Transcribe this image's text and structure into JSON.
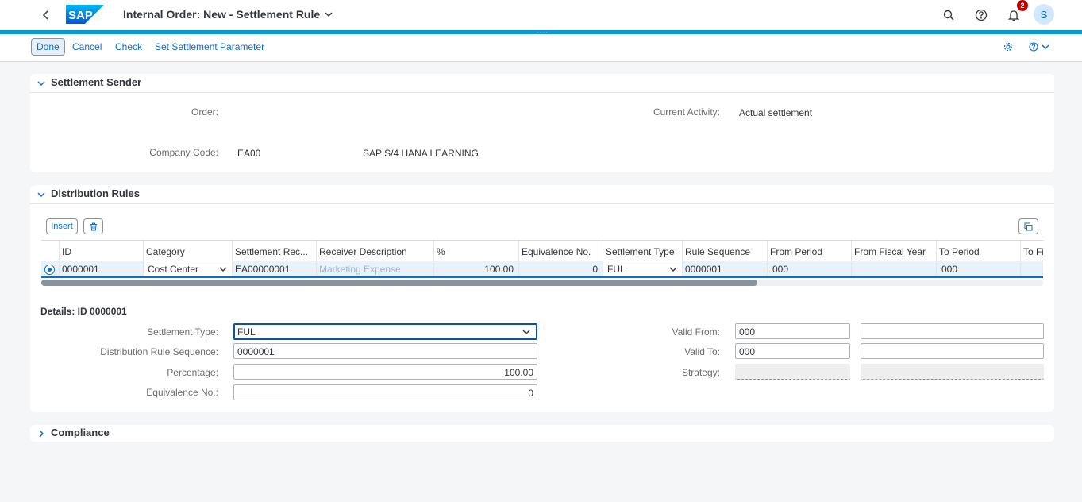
{
  "shell": {
    "title": "Internal Order: New - Settlement Rule",
    "notification_count": "2",
    "avatar_initial": "S",
    "logo_text": "SAP"
  },
  "toolbar": {
    "done": "Done",
    "cancel": "Cancel",
    "check": "Check",
    "set_param": "Set Settlement Parameter"
  },
  "sender": {
    "title": "Settlement Sender",
    "order_label": "Order:",
    "order_value": "",
    "activity_label": "Current Activity:",
    "activity_value": "Actual settlement",
    "company_label": "Company Code:",
    "company_code": "EA00",
    "company_name": "SAP S/4 HANA LEARNING"
  },
  "distribution": {
    "title": "Distribution Rules",
    "insert_label": "Insert",
    "columns": [
      "ID",
      "Category",
      "Settlement Rec...",
      "Receiver Description",
      "%",
      "Equivalence No.",
      "Settlement Type",
      "Rule Sequence",
      "From Period",
      "From Fiscal Year",
      "To Period",
      "To Fis"
    ],
    "row": {
      "id": "0000001",
      "category": "Cost Center",
      "receiver": "EA00000001",
      "description": "Marketing Expense",
      "percent": "100.00",
      "equivalence": "0",
      "settlement_type": "FUL",
      "rule_sequence": "0000001",
      "from_period": "000",
      "from_fiscal_year": "",
      "to_period": "000",
      "to_fiscal": ""
    }
  },
  "details": {
    "title": "Details: ID 0000001",
    "settlement_type_label": "Settlement Type:",
    "settlement_type_value": "FUL",
    "rule_sequence_label": "Distribution Rule Sequence:",
    "rule_sequence_value": "0000001",
    "percentage_label": "Percentage:",
    "percentage_value": "100.00",
    "equivalence_label": "Equivalence No.:",
    "equivalence_value": "0",
    "valid_from_label": "Valid From:",
    "valid_from_value": "000",
    "valid_from_year": "",
    "valid_to_label": "Valid To:",
    "valid_to_value": "000",
    "valid_to_year": "",
    "strategy_label": "Strategy:",
    "strategy_value": ""
  },
  "compliance": {
    "title": "Compliance"
  },
  "colors": {
    "accent": "#0a6ed1",
    "shell_line": "#0a99d8",
    "badge": "#bb0000"
  }
}
